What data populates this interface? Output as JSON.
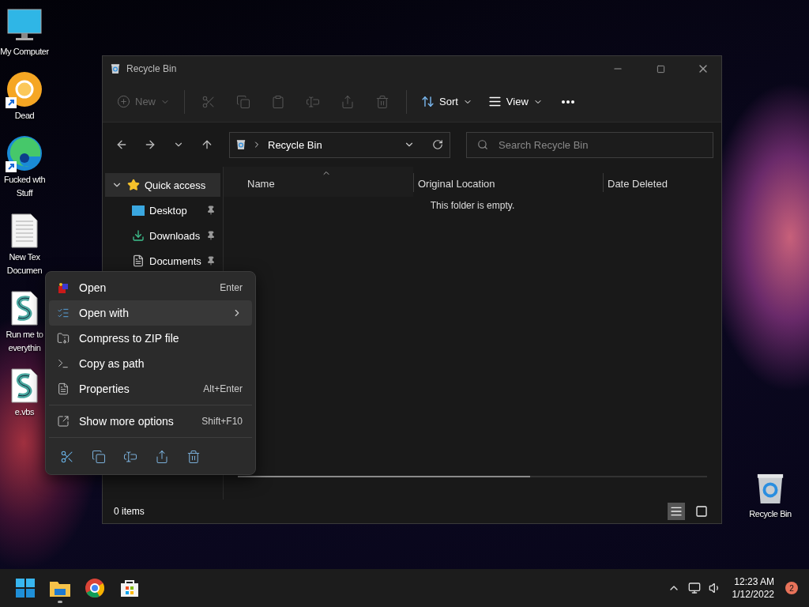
{
  "desktop_icons": [
    {
      "kind": "monitor",
      "lines": [
        "My Computer"
      ],
      "shortcut": false
    },
    {
      "kind": "chrome-canary",
      "lines": [
        "Dead"
      ],
      "shortcut": true
    },
    {
      "kind": "edge",
      "lines": [
        "Fucked wth",
        "Stuff"
      ],
      "shortcut": true
    },
    {
      "kind": "text",
      "lines": [
        "New Tex",
        "Documen"
      ],
      "shortcut": false
    },
    {
      "kind": "script",
      "lines": [
        "Run me to",
        "everythin"
      ],
      "shortcut": false
    },
    {
      "kind": "script",
      "lines": [
        "e.vbs"
      ],
      "shortcut": false
    }
  ],
  "desktop_recycle_bin": {
    "label": "Recycle Bin"
  },
  "window": {
    "title": "Recycle Bin",
    "toolbar": {
      "new": {
        "label": "New",
        "disabled": true
      },
      "actions": [
        {
          "kind": "cut",
          "disabled": true
        },
        {
          "kind": "copy",
          "disabled": true
        },
        {
          "kind": "paste",
          "disabled": true
        },
        {
          "kind": "rename",
          "disabled": true
        },
        {
          "kind": "share",
          "disabled": true
        },
        {
          "kind": "delete",
          "disabled": true
        }
      ],
      "sort": {
        "label": "Sort"
      },
      "view": {
        "label": "View"
      }
    },
    "address": {
      "path": "Recycle Bin"
    },
    "search": {
      "placeholder": "Search Recycle Bin"
    },
    "sidebar": {
      "items": [
        {
          "label": "Quick access",
          "kind": "star",
          "expanded": true,
          "selected": true,
          "children": [
            {
              "label": "Desktop",
              "kind": "desktop",
              "pinned": true,
              "selected": false
            },
            {
              "label": "Downloads",
              "kind": "downloads",
              "pinned": true,
              "selected": false
            },
            {
              "label": "Documents",
              "kind": "documents",
              "pinned": true,
              "selected": false
            }
          ]
        }
      ]
    },
    "columns": [
      {
        "label": "Name",
        "sorted": true
      },
      {
        "label": "Original Location",
        "sorted": false
      },
      {
        "label": "Date Deleted",
        "sorted": false
      }
    ],
    "empty_message": "This folder is empty.",
    "status": "0 items",
    "view_buttons": [
      {
        "kind": "details",
        "selected": true
      },
      {
        "kind": "tiles",
        "selected": false
      }
    ]
  },
  "context_menu": {
    "items": [
      {
        "kind": "open",
        "label": "Open",
        "shortcut": "Enter",
        "submenu": false,
        "selected": false
      },
      {
        "kind": "open-with",
        "label": "Open with",
        "submenu": true,
        "selected": true
      },
      {
        "kind": "zip",
        "label": "Compress to ZIP file",
        "submenu": false,
        "selected": false
      },
      {
        "kind": "path",
        "label": "Copy as path",
        "submenu": false,
        "selected": false
      },
      {
        "kind": "properties",
        "label": "Properties",
        "shortcut": "Alt+Enter",
        "submenu": false,
        "selected": false
      },
      {
        "kind": "more",
        "label": "Show more options",
        "shortcut": "Shift+F10",
        "submenu": false,
        "selected": false,
        "divider_before": true
      }
    ],
    "quick_actions": [
      {
        "kind": "cut"
      },
      {
        "kind": "copy"
      },
      {
        "kind": "rename"
      },
      {
        "kind": "share"
      },
      {
        "kind": "delete"
      }
    ]
  },
  "taskbar": {
    "apps": [
      {
        "kind": "start",
        "running": false
      },
      {
        "kind": "explorer",
        "running": true
      },
      {
        "kind": "chrome",
        "running": false
      },
      {
        "kind": "store",
        "running": false
      }
    ],
    "time": "12:23 AM",
    "date": "1/12/2022",
    "notifications": "2"
  }
}
